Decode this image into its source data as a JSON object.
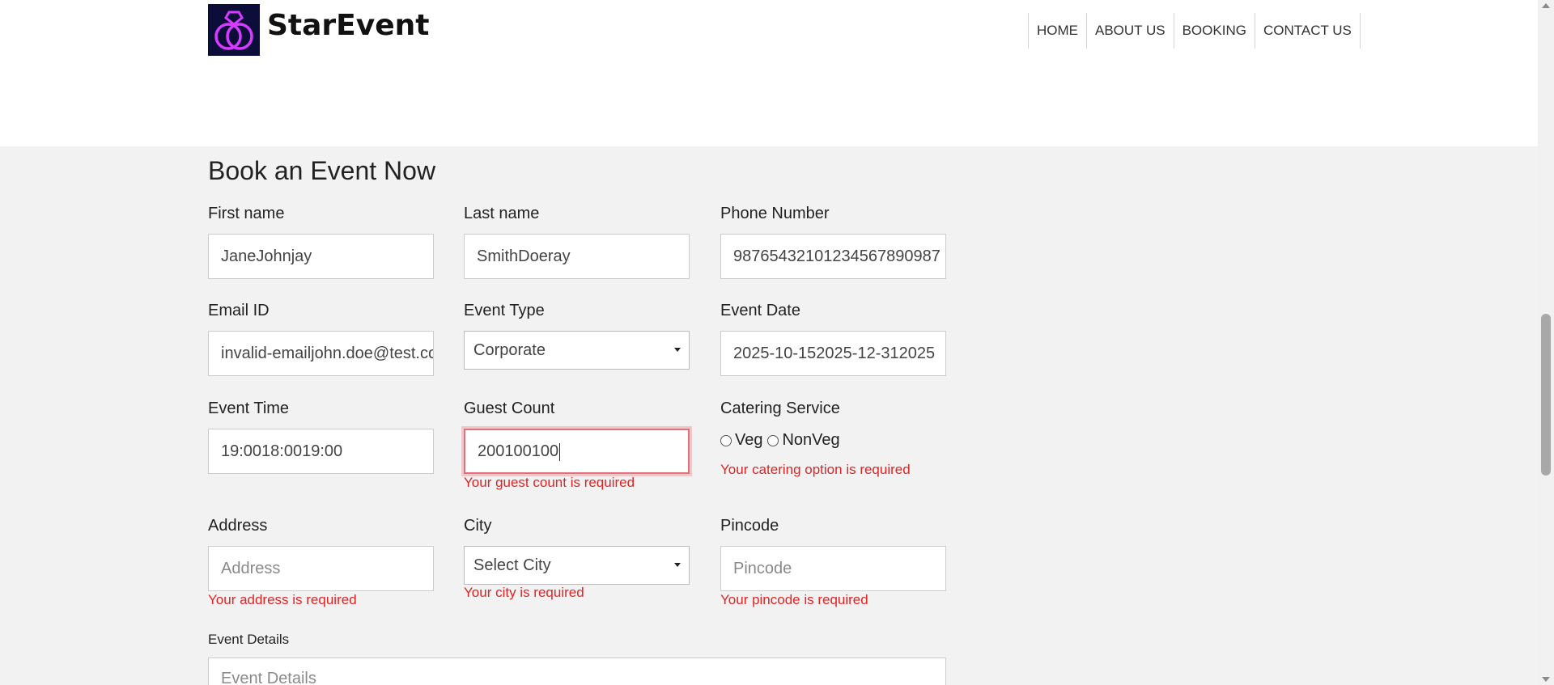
{
  "brand": {
    "name": "StarEvent",
    "logo_icon": "rings-logo-icon"
  },
  "nav": {
    "items": [
      "HOME",
      "ABOUT US",
      "BOOKING",
      "CONTACT US"
    ]
  },
  "form": {
    "title": "Book an Event Now",
    "first_name": {
      "label": "First name",
      "value": "JaneJohnjay"
    },
    "last_name": {
      "label": "Last name",
      "value": "SmithDoeray"
    },
    "phone": {
      "label": "Phone Number",
      "value": "98765432101234567890987"
    },
    "email": {
      "label": "Email ID",
      "value": "invalid-emailjohn.doe@test.com"
    },
    "event_type": {
      "label": "Event Type",
      "value": "Corporate"
    },
    "event_date": {
      "label": "Event Date",
      "value": "2025-10-152025-12-312025"
    },
    "event_time": {
      "label": "Event Time",
      "value": "19:0018:0019:00"
    },
    "guest_count": {
      "label": "Guest Count",
      "value": "200100100",
      "error": "Your guest count is required"
    },
    "catering": {
      "label": "Catering Service",
      "options": [
        "Veg",
        "NonVeg"
      ],
      "error": "Your catering option is required"
    },
    "address": {
      "label": "Address",
      "placeholder": "Address",
      "error": "Your address is required"
    },
    "city": {
      "label": "City",
      "value": "Select City",
      "error": "Your city is required"
    },
    "pincode": {
      "label": "Pincode",
      "placeholder": "Pincode",
      "error": "Your pincode is required"
    },
    "event_details": {
      "label": "Event Details",
      "placeholder": "Event Details"
    }
  },
  "colors": {
    "error": "#e02424",
    "section_bg": "#f2f2f2",
    "logo_neon": "#d63cff"
  }
}
